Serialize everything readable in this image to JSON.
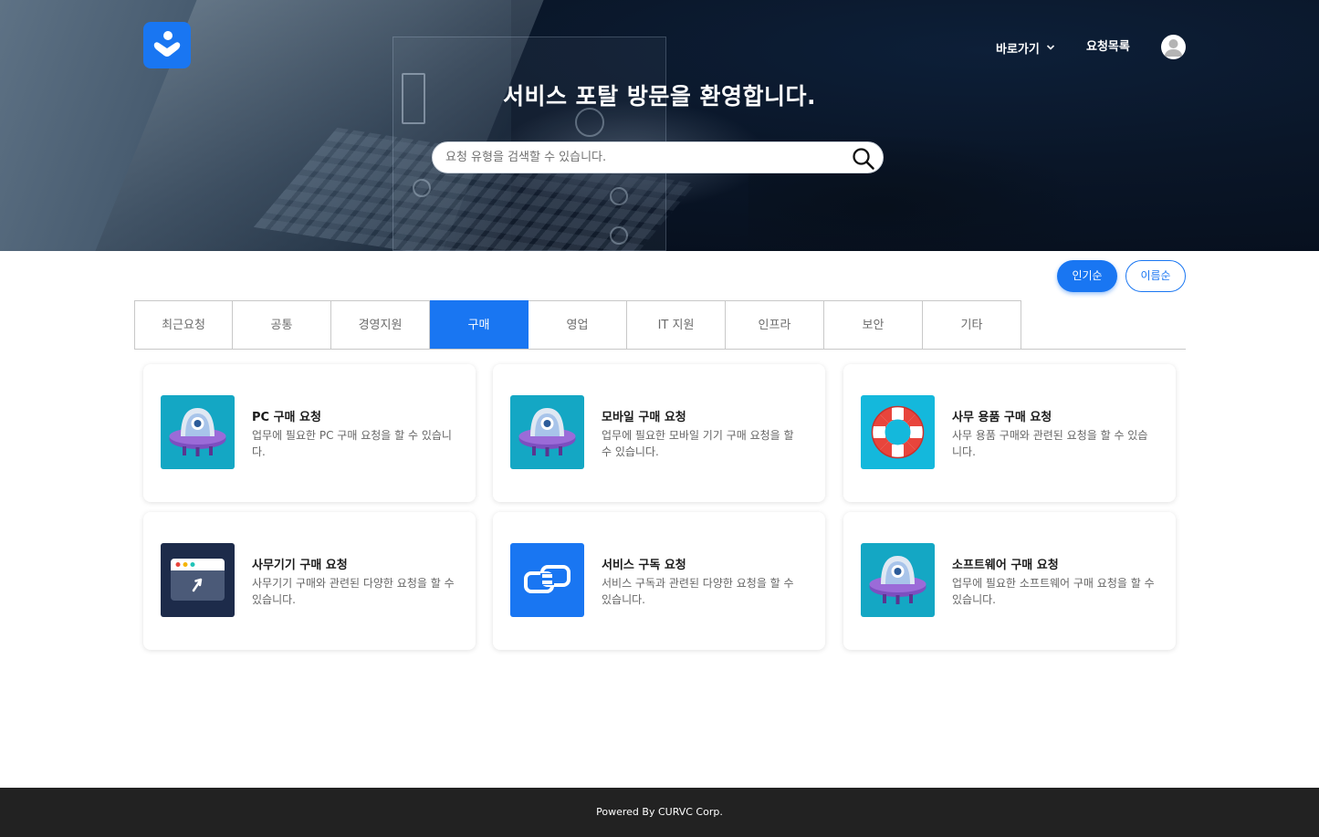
{
  "header": {
    "shortcut_label": "바로가기",
    "requests_label": "요청목록"
  },
  "hero": {
    "title": "서비스 포탈 방문을 환영합니다.",
    "search_placeholder": "요청 유형을 검색할 수 있습니다."
  },
  "sort": {
    "popular": "인기순",
    "name": "이름순"
  },
  "tabs": [
    {
      "label": "최근요청",
      "active": false
    },
    {
      "label": "공통",
      "active": false
    },
    {
      "label": "경영지원",
      "active": false
    },
    {
      "label": "구매",
      "active": true
    },
    {
      "label": "영업",
      "active": false
    },
    {
      "label": "IT 지원",
      "active": false
    },
    {
      "label": "인프라",
      "active": false
    },
    {
      "label": "보안",
      "active": false
    },
    {
      "label": "기타",
      "active": false
    }
  ],
  "cards": [
    {
      "title": "PC 구매 요청",
      "desc": "업무에 필요한 PC 구매 요청을 할 수 있습니다.",
      "icon": "robot-ufo-icon"
    },
    {
      "title": "모바일 구매 요청",
      "desc": "업무에 필요한 모바일 기기 구매 요청을 할 수 있습니다.",
      "icon": "robot-ufo-icon"
    },
    {
      "title": "사무 용품 구매 요청",
      "desc": "사무 용품 구매와 관련된 요청을 할 수 있습니다.",
      "icon": "lifebuoy-icon"
    },
    {
      "title": "사무기기 구매 요청",
      "desc": "사무기기 구매와 관련된 다양한 요청을 할 수 있습니다.",
      "icon": "browser-window-icon"
    },
    {
      "title": "서비스 구독 요청",
      "desc": "서비스 구독과 관련된 다양한 요청을 할 수 있습니다.",
      "icon": "link-icon"
    },
    {
      "title": "소프트웨어 구매 요청",
      "desc": "업무에 필요한 소프트웨어 구매 요청을 할 수 있습니다.",
      "icon": "robot-ufo-icon"
    }
  ],
  "colors": {
    "accent": "#1976f2",
    "footer": "#222222"
  },
  "footer": {
    "text": "Powered By CURVC Corp."
  }
}
